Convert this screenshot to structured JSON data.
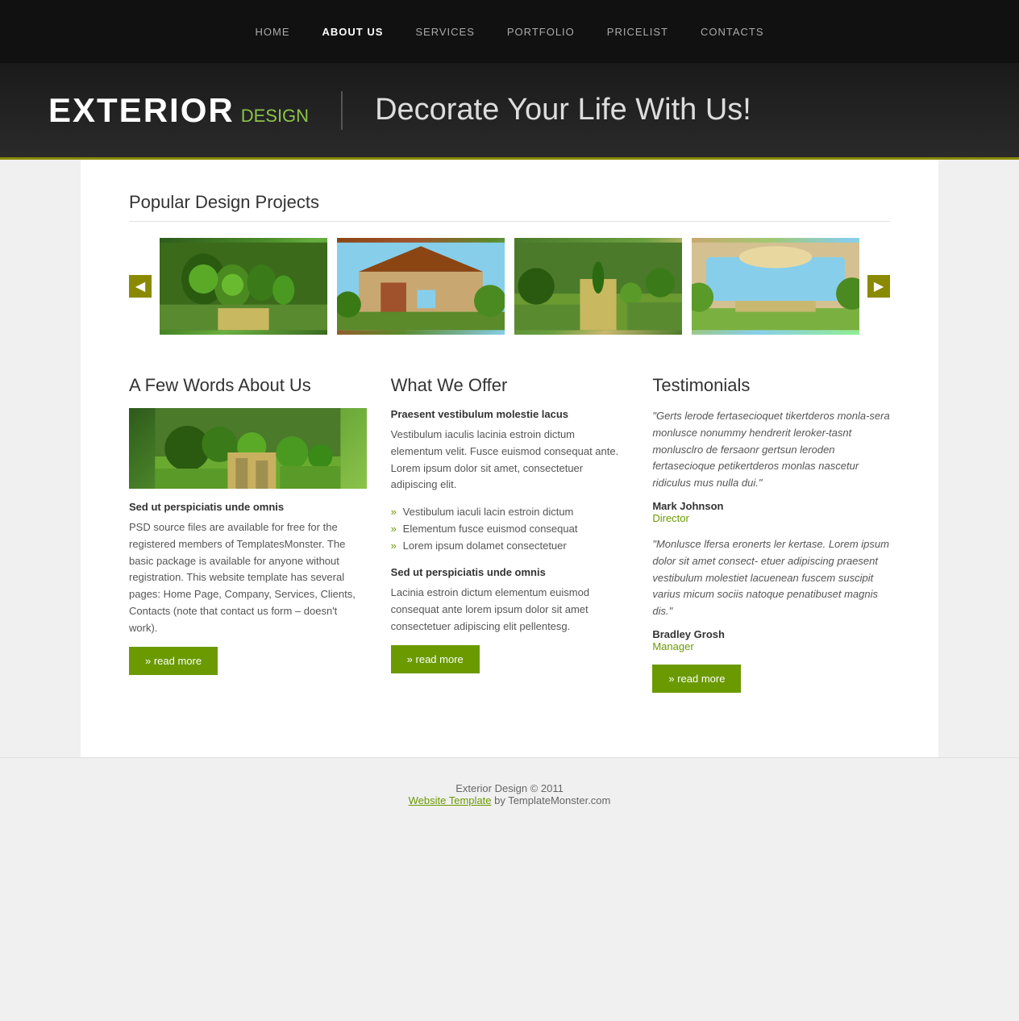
{
  "nav": {
    "items": [
      {
        "label": "HOME",
        "active": false
      },
      {
        "label": "ABOUT US",
        "active": true
      },
      {
        "label": "SERVICES",
        "active": false
      },
      {
        "label": "PORTFOLIO",
        "active": false
      },
      {
        "label": "PRICELIST",
        "active": false
      },
      {
        "label": "CONTACTS",
        "active": false
      }
    ]
  },
  "hero": {
    "logo_main": "EXTERIOR",
    "logo_sub": "DESIGN",
    "tagline": "Decorate Your Life With Us!"
  },
  "projects": {
    "section_title": "Popular Design Projects"
  },
  "about": {
    "title": "A Few Words About Us",
    "subtitle": "Sed ut perspiciatis unde omnis",
    "text": "PSD source files are available for free for the registered members of TemplatesMonster. The basic package is available for anyone without registration. This website template has several pages: Home Page, Company, Services, Clients, Contacts (note that contact us form – doesn't work).",
    "read_more": "» read more"
  },
  "offer": {
    "title": "What We Offer",
    "subtitle1": "Praesent vestibulum molestie lacus",
    "text1": "Vestibulum iaculis lacinia estroin dictum elementum velit. Fusce euismod consequat ante. Lorem ipsum dolor sit amet, consectetuer adipiscing elit.",
    "bullets": [
      "Vestibulum iaculi lacin estroin dictum",
      "Elementum fusce euismod consequat",
      "Lorem ipsum dolamet consectetuer"
    ],
    "subtitle2": "Sed ut perspiciatis unde omnis",
    "text2": "Lacinia estroin dictum elementum euismod consequat ante lorem ipsum dolor sit amet consectetuer adipiscing elit pellentesg.",
    "read_more": "» read more"
  },
  "testimonials": {
    "title": "Testimonials",
    "items": [
      {
        "text": "\"Gerts lerode fertasecioquet tikertderos monla-sera monlusce nonummy hendrerit leroker-tasnt monlusclro de fersaonr gertsun leroden fertasecioque petikertderos monlas nascetur ridiculus mus nulla dui.\"",
        "name": "Mark Johnson",
        "role": "Director"
      },
      {
        "text": "\"Monlusce lfersa eronerts ler kertase. Lorem ipsum dolor sit amet consect- etuer adipiscing praesent vestibulum molestiet lacuenean fuscem suscipit varius micum sociis natoque penatibuset magnis dis.\"",
        "name": "Bradley Grosh",
        "role": "Manager"
      }
    ],
    "read_more": "» read more"
  },
  "footer": {
    "copyright": "Exterior Design © 2011",
    "link_text": "Website Template",
    "suffix": " by TemplateMonster.com"
  }
}
